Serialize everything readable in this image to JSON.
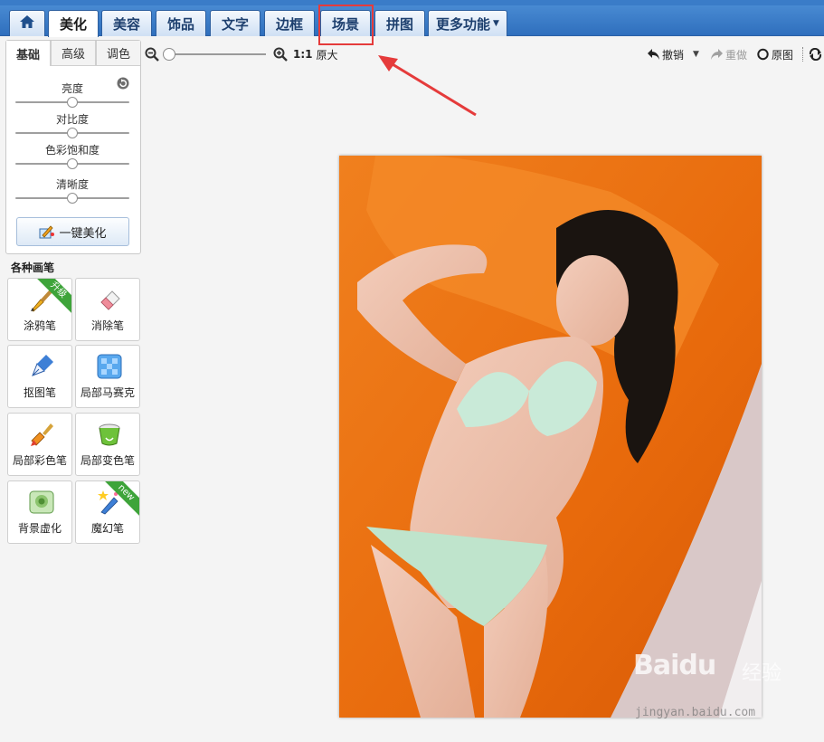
{
  "tabs": [
    {
      "label": "美化",
      "active": true
    },
    {
      "label": "美容"
    },
    {
      "label": "饰品"
    },
    {
      "label": "文字"
    },
    {
      "label": "边框"
    },
    {
      "label": "场景",
      "highlighted": true
    },
    {
      "label": "拼图"
    },
    {
      "label": "更多功能"
    }
  ],
  "zoom": {
    "ratio_label": "1:1",
    "actual_label": "原大",
    "level": 0
  },
  "history": {
    "undo_label": "撤销",
    "redo_label": "重做",
    "original_label": "原图"
  },
  "panel": {
    "tabs": [
      "基础",
      "高级",
      "调色"
    ],
    "active_tab": "基础",
    "sliders": [
      {
        "label": "亮度",
        "value": 0.5
      },
      {
        "label": "对比度",
        "value": 0.5
      },
      {
        "label": "色彩饱和度",
        "value": 0.5
      },
      {
        "label": "清晰度",
        "value": 0.5
      }
    ],
    "onekey_label": "一键美化"
  },
  "brushes": {
    "title": "各种画笔",
    "items": [
      {
        "label": "涂鸦笔",
        "badge": "升级"
      },
      {
        "label": "消除笔"
      },
      {
        "label": "抠图笔"
      },
      {
        "label": "局部马赛克"
      },
      {
        "label": "局部彩色笔"
      },
      {
        "label": "局部变色笔"
      },
      {
        "label": "背景虚化"
      },
      {
        "label": "魔幻笔",
        "badge": "new"
      }
    ]
  },
  "watermark": {
    "brand": "Baidu",
    "brand_cn": "经验",
    "url": "jingyan.baidu.com"
  },
  "colors": {
    "accent": "#2f6fbd",
    "highlight": "#e53b3b",
    "arrow": "#e53b3b",
    "photo_bg": "#e8700f"
  }
}
